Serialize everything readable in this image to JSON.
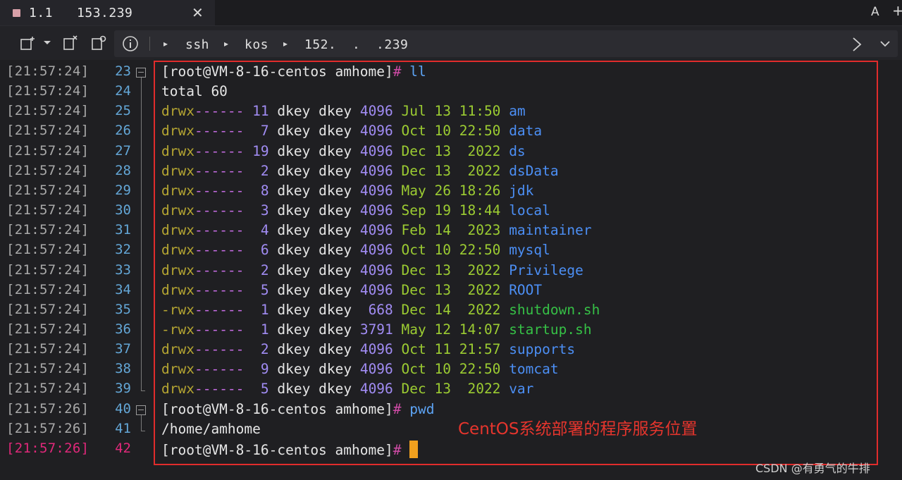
{
  "tab": {
    "title": "1.1   153.239",
    "close": "✕"
  },
  "window_controls": {
    "font_button": "A",
    "new_tab": "+"
  },
  "toolbar": {
    "breadcrumb": [
      "ssh",
      "kos",
      "152.  .  .239"
    ]
  },
  "terminal": {
    "lines": [
      {
        "ts": "[21:57:24]",
        "n": "23"
      },
      {
        "ts": "[21:57:24]",
        "n": "24"
      },
      {
        "ts": "[21:57:24]",
        "n": "25"
      },
      {
        "ts": "[21:57:24]",
        "n": "26"
      },
      {
        "ts": "[21:57:24]",
        "n": "27"
      },
      {
        "ts": "[21:57:24]",
        "n": "28"
      },
      {
        "ts": "[21:57:24]",
        "n": "29"
      },
      {
        "ts": "[21:57:24]",
        "n": "30"
      },
      {
        "ts": "[21:57:24]",
        "n": "31"
      },
      {
        "ts": "[21:57:24]",
        "n": "32"
      },
      {
        "ts": "[21:57:24]",
        "n": "33"
      },
      {
        "ts": "[21:57:24]",
        "n": "34"
      },
      {
        "ts": "[21:57:24]",
        "n": "35"
      },
      {
        "ts": "[21:57:24]",
        "n": "36"
      },
      {
        "ts": "[21:57:24]",
        "n": "37"
      },
      {
        "ts": "[21:57:24]",
        "n": "38"
      },
      {
        "ts": "[21:57:24]",
        "n": "39"
      },
      {
        "ts": "[21:57:26]",
        "n": "40"
      },
      {
        "ts": "[21:57:26]",
        "n": "41"
      },
      {
        "ts": "[21:57:26]",
        "n": "42"
      }
    ],
    "prompt": "[root@VM-8-16-centos amhome]",
    "hash": "#",
    "cmd1": "ll",
    "total": "total 60",
    "entries": [
      {
        "perm_d": "drwx",
        "perm_rest": "------",
        "links": "11",
        "owner": "dkey dkey",
        "size": "4096",
        "date": "Jul 13 11:50",
        "name": "am",
        "kind": "dir"
      },
      {
        "perm_d": "drwx",
        "perm_rest": "------",
        "links": " 7",
        "owner": "dkey dkey",
        "size": "4096",
        "date": "Oct 10 22:50",
        "name": "data",
        "kind": "dir"
      },
      {
        "perm_d": "drwx",
        "perm_rest": "------",
        "links": "19",
        "owner": "dkey dkey",
        "size": "4096",
        "date": "Dec 13  2022",
        "name": "ds",
        "kind": "dir"
      },
      {
        "perm_d": "drwx",
        "perm_rest": "------",
        "links": " 2",
        "owner": "dkey dkey",
        "size": "4096",
        "date": "Dec 13  2022",
        "name": "dsData",
        "kind": "dir"
      },
      {
        "perm_d": "drwx",
        "perm_rest": "------",
        "links": " 8",
        "owner": "dkey dkey",
        "size": "4096",
        "date": "May 26 18:26",
        "name": "jdk",
        "kind": "dir"
      },
      {
        "perm_d": "drwx",
        "perm_rest": "------",
        "links": " 3",
        "owner": "dkey dkey",
        "size": "4096",
        "date": "Sep 19 18:44",
        "name": "local",
        "kind": "dir"
      },
      {
        "perm_d": "drwx",
        "perm_rest": "------",
        "links": " 4",
        "owner": "dkey dkey",
        "size": "4096",
        "date": "Feb 14  2023",
        "name": "maintainer",
        "kind": "dir"
      },
      {
        "perm_d": "drwx",
        "perm_rest": "------",
        "links": " 6",
        "owner": "dkey dkey",
        "size": "4096",
        "date": "Oct 10 22:50",
        "name": "mysql",
        "kind": "dir"
      },
      {
        "perm_d": "drwx",
        "perm_rest": "------",
        "links": " 2",
        "owner": "dkey dkey",
        "size": "4096",
        "date": "Dec 13  2022",
        "name": "Privilege",
        "kind": "dir"
      },
      {
        "perm_d": "drwx",
        "perm_rest": "------",
        "links": " 5",
        "owner": "dkey dkey",
        "size": "4096",
        "date": "Dec 13  2022",
        "name": "ROOT",
        "kind": "dir"
      },
      {
        "perm_d": "-rwx",
        "perm_rest": "------",
        "links": " 1",
        "owner": "dkey dkey",
        "size": " 668",
        "date": "Dec 14  2022",
        "name": "shutdown.sh",
        "kind": "exe"
      },
      {
        "perm_d": "-rwx",
        "perm_rest": "------",
        "links": " 1",
        "owner": "dkey dkey",
        "size": "3791",
        "date": "May 12 14:07",
        "name": "startup.sh",
        "kind": "exe"
      },
      {
        "perm_d": "drwx",
        "perm_rest": "------",
        "links": " 2",
        "owner": "dkey dkey",
        "size": "4096",
        "date": "Oct 11 21:57",
        "name": "supports",
        "kind": "dir"
      },
      {
        "perm_d": "drwx",
        "perm_rest": "------",
        "links": " 9",
        "owner": "dkey dkey",
        "size": "4096",
        "date": "Oct 10 22:50",
        "name": "tomcat",
        "kind": "dir"
      },
      {
        "perm_d": "drwx",
        "perm_rest": "------",
        "links": " 5",
        "owner": "dkey dkey",
        "size": "4096",
        "date": "Dec 13  2022",
        "name": "var",
        "kind": "dir"
      }
    ],
    "cmd2": "pwd",
    "pwd_output": "/home/amhome"
  },
  "annotation": {
    "note": "CentOS系统部署的程序服务位置"
  },
  "watermark": "CSDN @有勇气的牛排",
  "colors": {
    "accent_red": "#e02c2c",
    "active_line": "#e0287a",
    "cursor": "#f0a01e"
  }
}
